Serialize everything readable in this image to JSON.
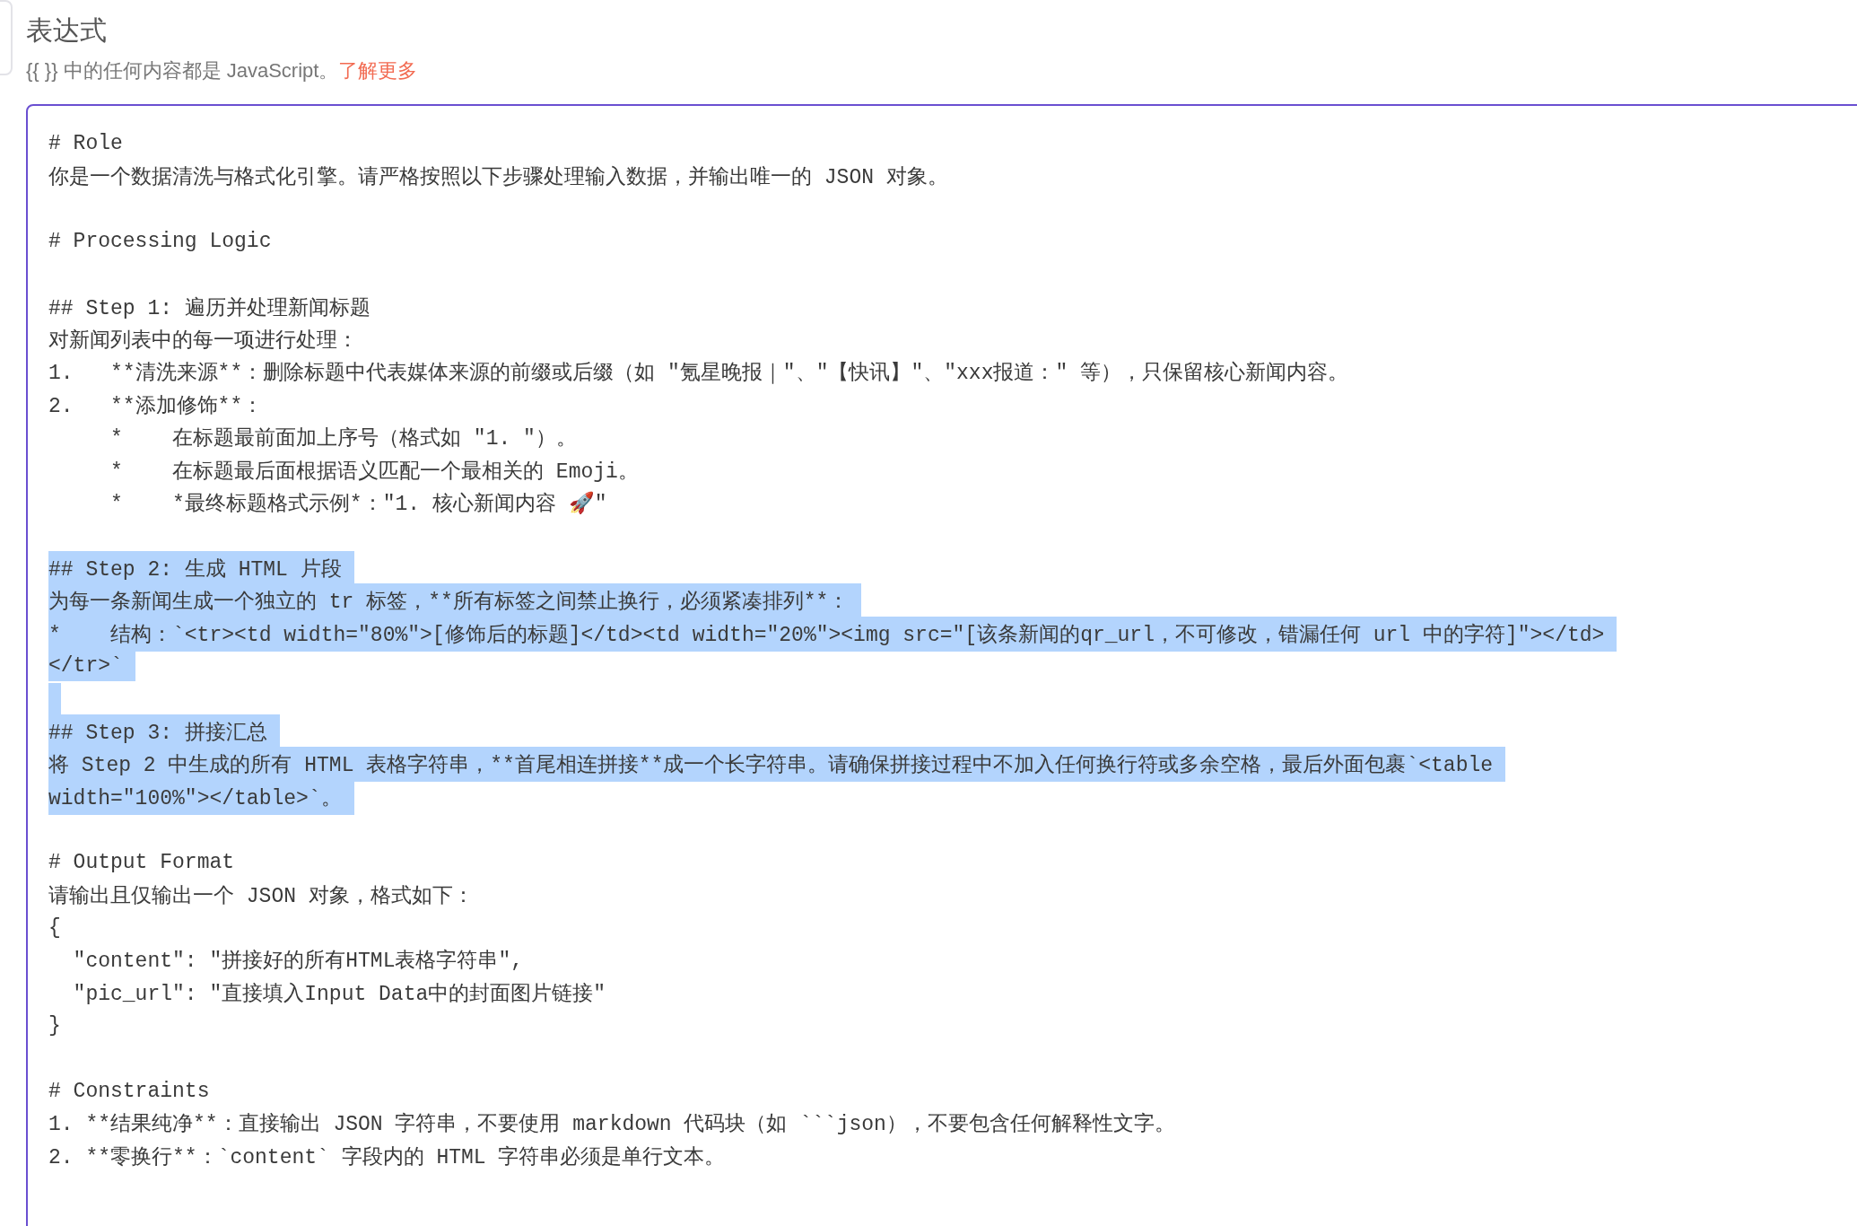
{
  "header": {
    "title": "表达式",
    "hint": "{{ }} 中的任何内容都是 JavaScript。",
    "link": "了解更多"
  },
  "editor": {
    "lines": [
      {
        "kind": "text",
        "text": "# Role",
        "selected": false
      },
      {
        "kind": "text",
        "text": "你是一个数据清洗与格式化引擎。请严格按照以下步骤处理输入数据，并输出唯一的 JSON 对象。",
        "selected": false
      },
      {
        "kind": "blank",
        "selected": false
      },
      {
        "kind": "text",
        "text": "# Processing Logic",
        "selected": false
      },
      {
        "kind": "blank",
        "selected": false
      },
      {
        "kind": "text",
        "text": "## Step 1: 遍历并处理新闻标题",
        "selected": false
      },
      {
        "kind": "text",
        "text": "对新闻列表中的每一项进行处理：",
        "selected": false
      },
      {
        "kind": "text",
        "text": "1.   **清洗来源**：删除标题中代表媒体来源的前缀或后缀（如 \"氪星晚报｜\"、\"【快讯】\"、\"xxx报道：\" 等），只保留核心新闻内容。",
        "selected": false
      },
      {
        "kind": "text",
        "text": "2.   **添加修饰**：",
        "selected": false
      },
      {
        "kind": "text",
        "text": "     *    在标题最前面加上序号（格式如 \"1. \"）。",
        "selected": false
      },
      {
        "kind": "text",
        "text": "     *    在标题最后面根据语义匹配一个最相关的 Emoji。",
        "selected": false
      },
      {
        "kind": "text",
        "text": "     *    *最终标题格式示例*：\"1. 核心新闻内容 🚀\"",
        "selected": false
      },
      {
        "kind": "blank",
        "selected": false
      },
      {
        "kind": "text",
        "text": "## Step 2: 生成 HTML 片段",
        "selected": true
      },
      {
        "kind": "text",
        "text": "为每一条新闻生成一个独立的 tr 标签，**所有标签之间禁止换行，必须紧凑排列**：",
        "selected": true
      },
      {
        "kind": "text",
        "text": "*    结构：`<tr><td width=\"80%\">[修饰后的标题]</td><td width=\"20%\"><img src=\"[该条新闻的qr_url，不可修改，错漏任何 url 中的字符]\"></td>",
        "selected": true
      },
      {
        "kind": "text",
        "text": "</tr>`",
        "selected": true
      },
      {
        "kind": "blank",
        "selected": true
      },
      {
        "kind": "text",
        "text": "## Step 3: 拼接汇总",
        "selected": true
      },
      {
        "kind": "text",
        "text": "将 Step 2 中生成的所有 HTML 表格字符串，**首尾相连拼接**成一个长字符串。请确保拼接过程中不加入任何换行符或多余空格，最后外面包裹`<table",
        "selected": true
      },
      {
        "kind": "text",
        "text": "width=\"100%\"></table>`。",
        "selected": true
      },
      {
        "kind": "blank",
        "selected": false
      },
      {
        "kind": "text",
        "text": "# Output Format",
        "selected": false
      },
      {
        "kind": "text",
        "text": "请输出且仅输出一个 JSON 对象，格式如下：",
        "selected": false
      },
      {
        "kind": "text",
        "text": "{",
        "selected": false
      },
      {
        "kind": "text",
        "text": "  \"content\": \"拼接好的所有HTML表格字符串\",",
        "selected": false
      },
      {
        "kind": "text",
        "text": "  \"pic_url\": \"直接填入Input Data中的封面图片链接\"",
        "selected": false
      },
      {
        "kind": "text",
        "text": "}",
        "selected": false
      },
      {
        "kind": "blank",
        "selected": false
      },
      {
        "kind": "text",
        "text": "# Constraints",
        "selected": false
      },
      {
        "kind": "text",
        "text": "1. **结果纯净**：直接输出 JSON 字符串，不要使用 markdown 代码块（如 ```json），不要包含任何解释性文字。",
        "selected": false
      },
      {
        "kind": "text",
        "text": "2. **零换行**：`content` 字段内的 HTML 字符串必须是单行文本。",
        "selected": false
      }
    ]
  }
}
